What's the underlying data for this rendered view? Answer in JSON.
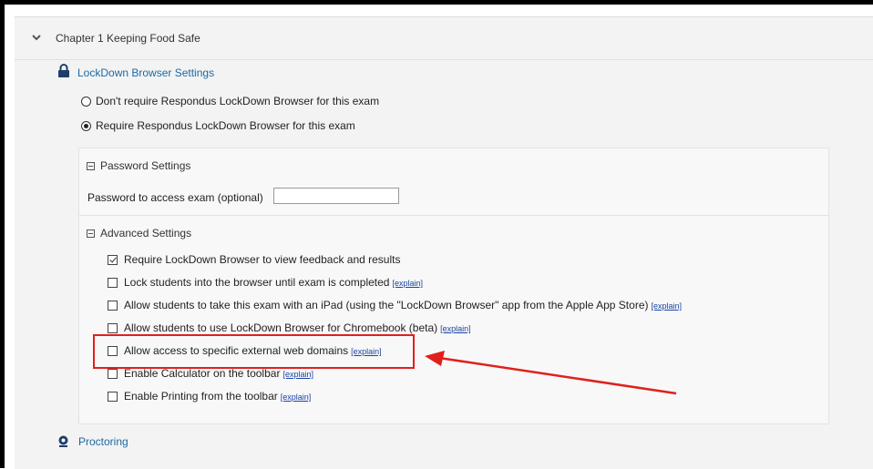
{
  "chapter": {
    "title": "Chapter 1 Keeping Food Safe"
  },
  "lockdown": {
    "title": "LockDown Browser Settings",
    "radio_options": [
      {
        "label": "Don't require Respondus LockDown Browser for this exam",
        "selected": false
      },
      {
        "label": "Require Respondus LockDown Browser for this exam",
        "selected": true
      }
    ]
  },
  "password_settings": {
    "heading": "Password Settings",
    "field_label": "Password to access exam (optional)",
    "field_value": ""
  },
  "advanced_settings": {
    "heading": "Advanced Settings",
    "options": [
      {
        "label": "Require LockDown Browser to view feedback and results",
        "checked": true,
        "explain": ""
      },
      {
        "label": "Lock students into the browser until exam is completed",
        "checked": false,
        "explain": "[explain]"
      },
      {
        "label": "Allow students to take this exam with an iPad (using the \"LockDown Browser\" app from the Apple App Store)",
        "checked": false,
        "explain": "[explain]"
      },
      {
        "label": "Allow students to use LockDown Browser for Chromebook (beta)",
        "checked": false,
        "explain": "[explain]"
      },
      {
        "label": "Allow access to specific external web domains",
        "checked": false,
        "explain": "[explain]"
      },
      {
        "label": "Enable Calculator on the toolbar",
        "checked": false,
        "explain": "[explain]"
      },
      {
        "label": "Enable Printing from the toolbar",
        "checked": false,
        "explain": "[explain]"
      }
    ]
  },
  "proctoring": {
    "title": "Proctoring"
  },
  "colors": {
    "link": "#1a6aa3",
    "annotation": "#e0201c"
  }
}
